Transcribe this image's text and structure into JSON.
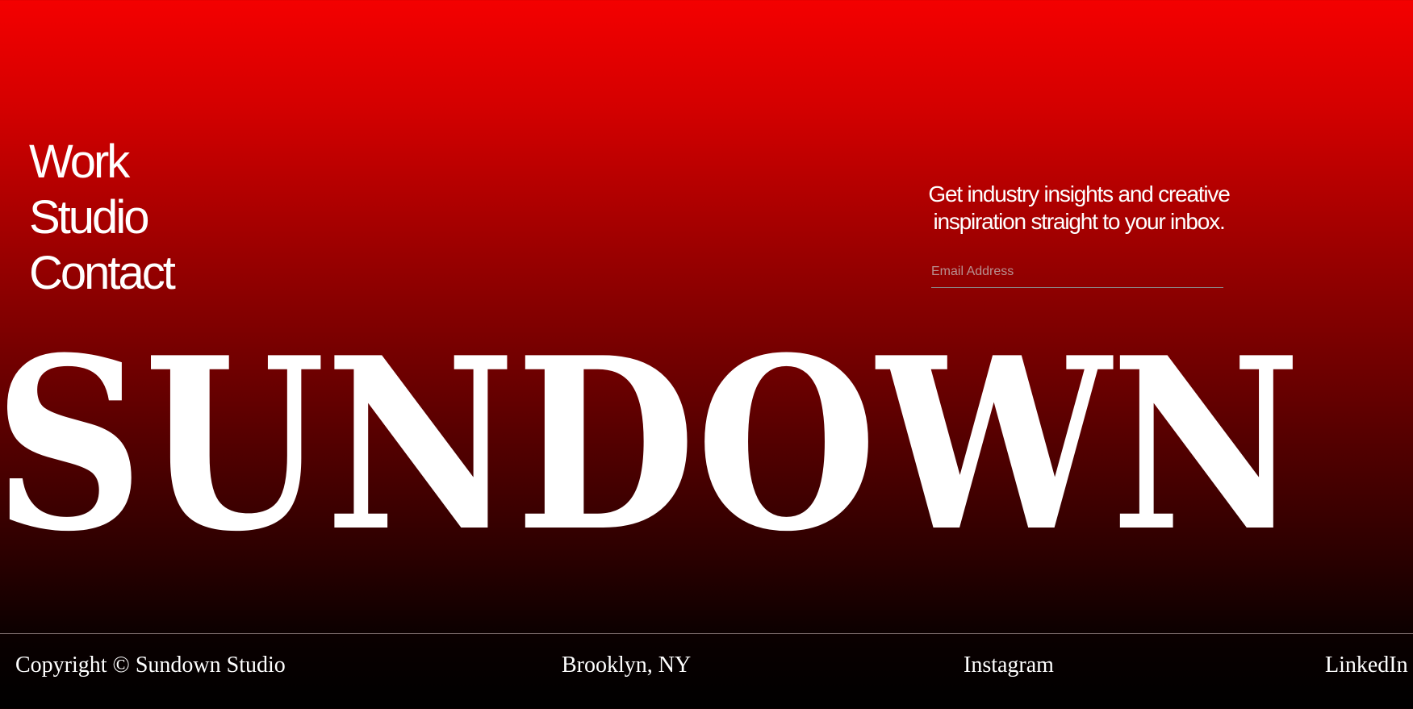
{
  "nav": {
    "items": [
      {
        "label": "Work"
      },
      {
        "label": "Studio"
      },
      {
        "label": "Contact"
      }
    ]
  },
  "newsletter": {
    "text": "Get industry insights and creative inspiration straight to your inbox.",
    "email_placeholder": "Email Address",
    "email_value": ""
  },
  "brand": {
    "name": "SUNDOWN"
  },
  "footer": {
    "copyright": "Copyright © Sundown Studio",
    "location": "Brooklyn, NY",
    "instagram": "Instagram",
    "linkedin": "LinkedIn"
  },
  "colors": {
    "top": "#f40000",
    "bottom": "#000000",
    "text": "#ffffff"
  }
}
